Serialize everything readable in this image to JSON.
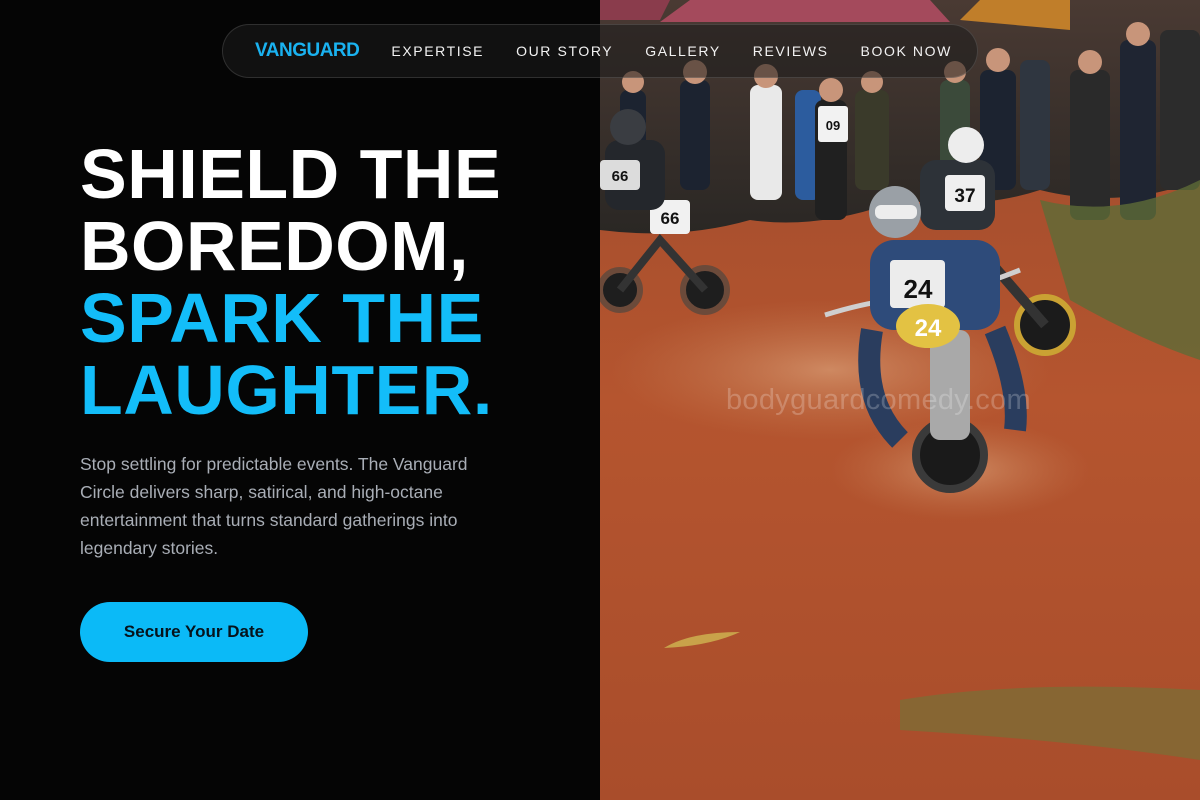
{
  "nav": {
    "brand": "VANGUARD",
    "links": [
      "EXPERTISE",
      "OUR STORY",
      "GALLERY",
      "REVIEWS",
      "BOOK NOW"
    ]
  },
  "hero": {
    "headline_white": [
      "SHIELD THE",
      "BOREDOM,"
    ],
    "headline_accent": [
      "SPARK THE",
      "LAUGHTER."
    ],
    "description": "Stop settling for predictable events. The Vanguard Circle delivers sharp, satirical, and high-octane entertainment that turns standard gatherings into legendary stories.",
    "cta_label": "Secure Your Date"
  },
  "image": {
    "watermark": "bodyguardcomedy.com",
    "bib_numbers": [
      "24",
      "37",
      "66",
      "66",
      "09"
    ]
  },
  "colors": {
    "background": "#050505",
    "accent": "#13bdf9",
    "brand": "#1ab2f0",
    "cta_background": "#0bbaf7",
    "body_text": "#a9aeb6",
    "dirt": "#b5552f"
  }
}
